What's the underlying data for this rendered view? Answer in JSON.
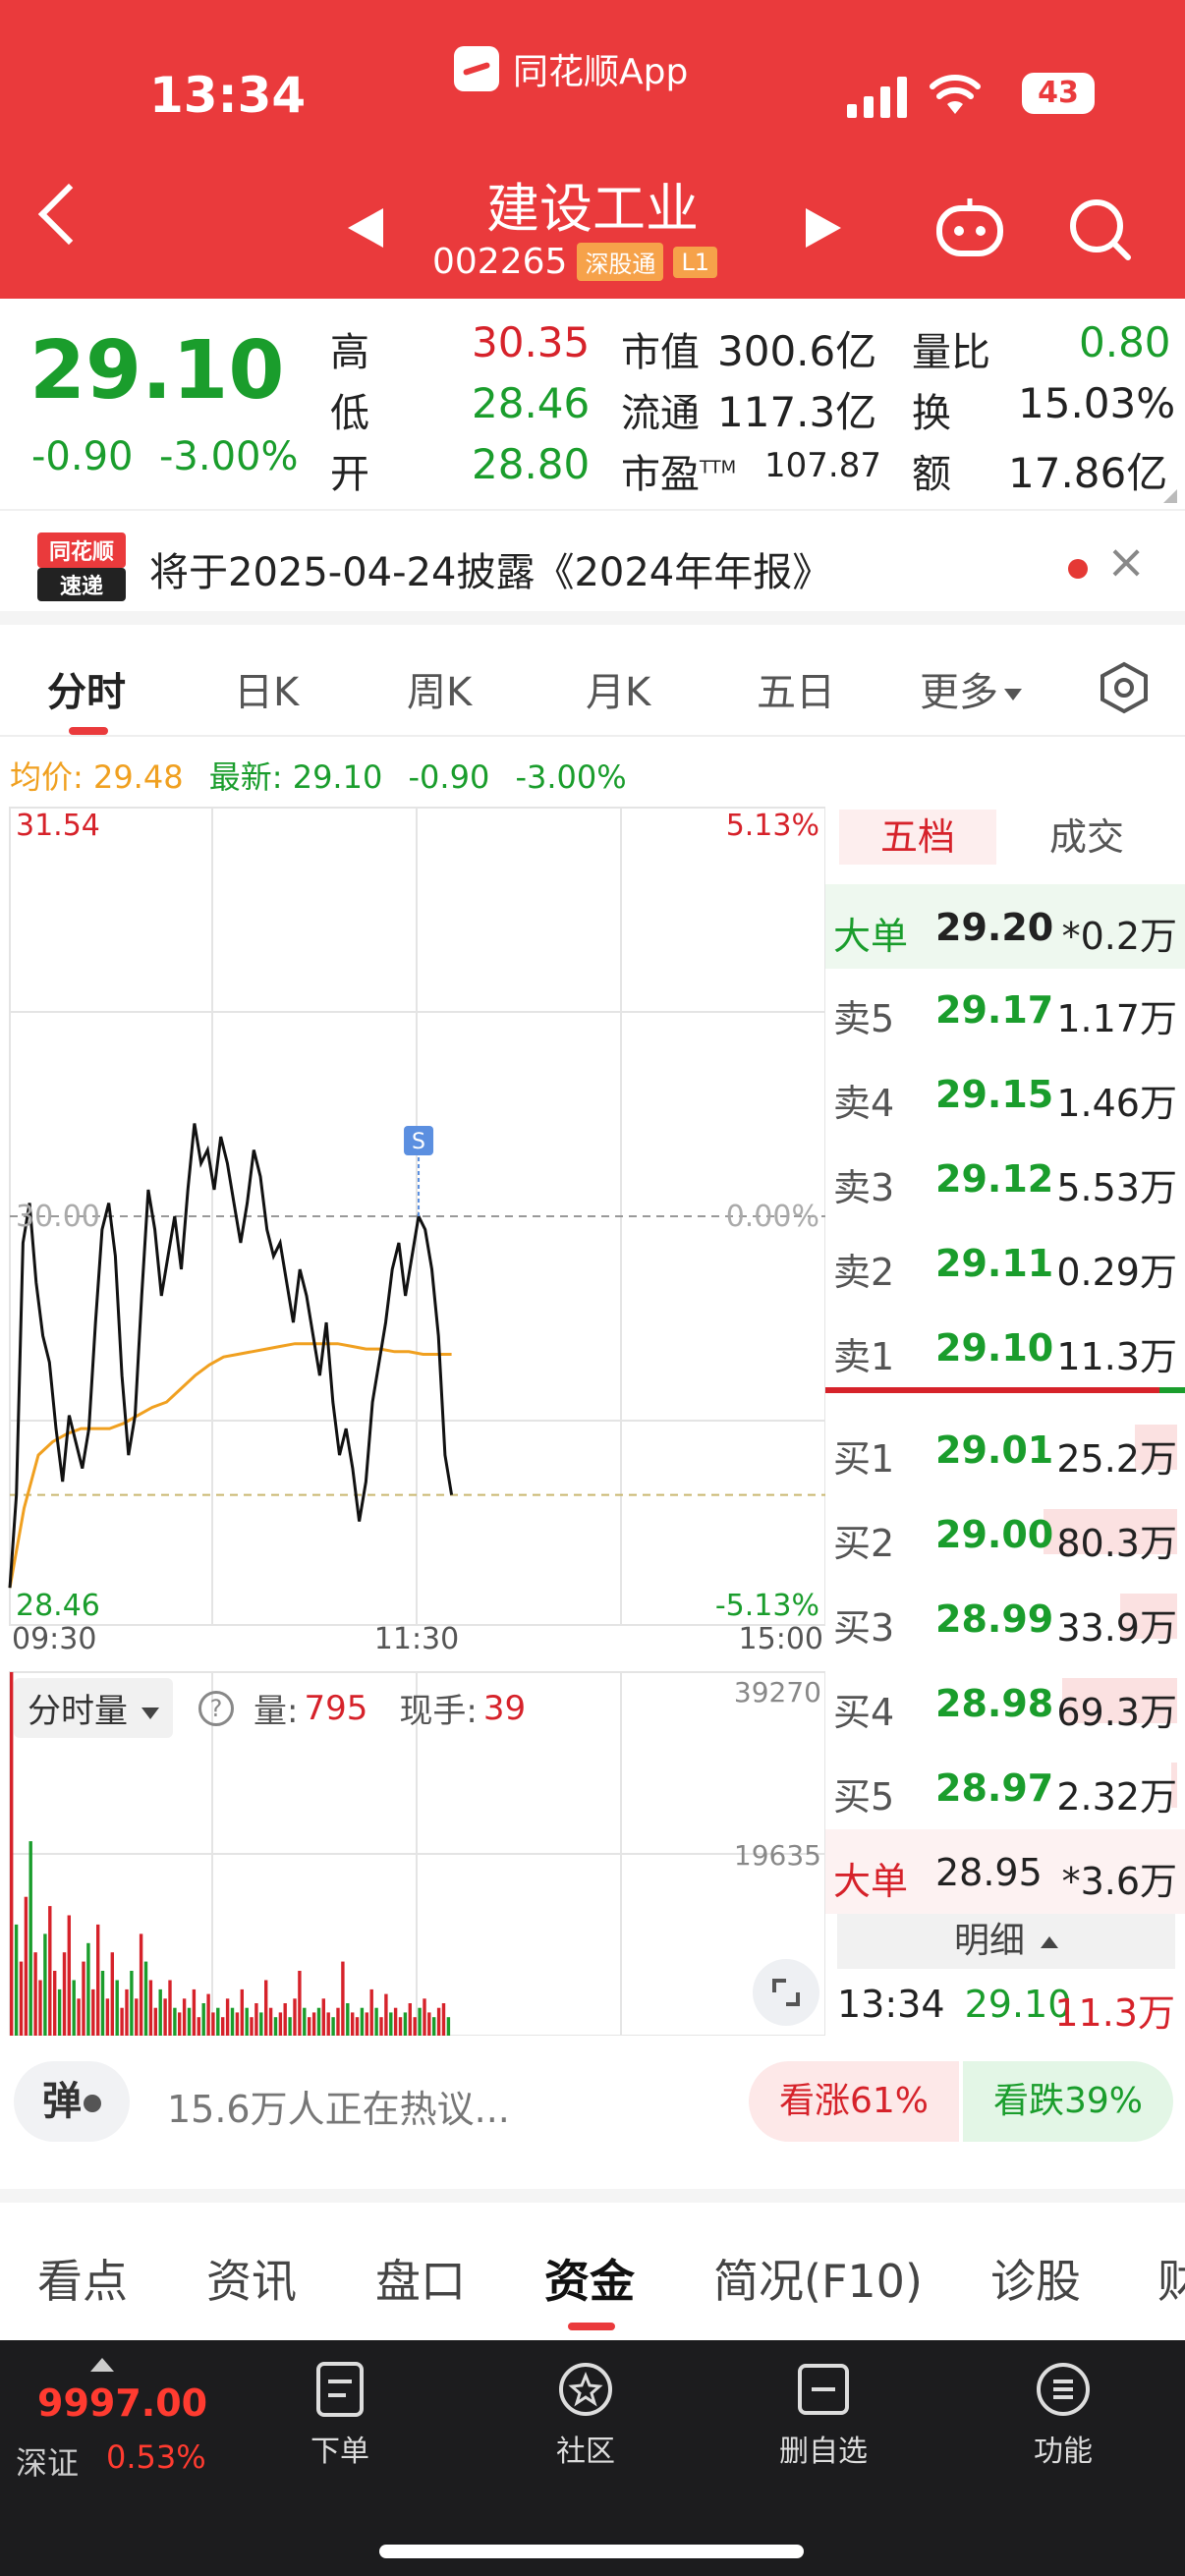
{
  "status": {
    "time": "13:34",
    "battery": "43"
  },
  "app": {
    "name": "同花顺App"
  },
  "stock": {
    "name": "建设工业",
    "code": "002265",
    "tags": [
      "深股通",
      "L1"
    ]
  },
  "quote": {
    "price": "29.10",
    "change": "-0.90",
    "change_pct": "-3.00%",
    "high_label": "高",
    "high": "30.35",
    "low_label": "低",
    "low": "28.46",
    "open_label": "开",
    "open": "28.80",
    "mktcap_label": "市值",
    "mktcap": "300.6亿",
    "float_label": "流通",
    "float": "117.3亿",
    "pe_label": "市盈",
    "pe_sup": "TTM",
    "pe": "107.87",
    "vol_ratio_label": "量比",
    "vol_ratio": "0.80",
    "turnover_label": "换",
    "turnover": "15.03%",
    "amount_label": "额",
    "amount": "17.86亿"
  },
  "notice": {
    "logo_top": "同花顺",
    "logo_bottom": "速递",
    "text": "将于2025-04-24披露《2024年年报》"
  },
  "period_tabs": [
    "分时",
    "日K",
    "周K",
    "月K",
    "五日",
    "更多"
  ],
  "avg_line": {
    "avg": "均价: 29.48",
    "latest": "最新: 29.10",
    "chg": "-0.90",
    "pct": "-3.00%"
  },
  "chart_data": {
    "type": "line",
    "title": "",
    "x_ticks": [
      "09:30",
      "11:30",
      "15:00"
    ],
    "ylim": [
      28.46,
      31.54
    ],
    "y_labels": {
      "top": "31.54",
      "mid": "30.00",
      "bottom": "28.46"
    },
    "pct_labels": {
      "top": "5.13%",
      "mid": "0.00%",
      "bottom": "-5.13%"
    },
    "prev_close": 30.0,
    "marker": "S",
    "series": [
      {
        "values": [
          28.6,
          28.95,
          29.9,
          30.05,
          29.75,
          29.55,
          29.45,
          29.2,
          29.0,
          29.25,
          29.15,
          29.05,
          29.2,
          29.6,
          29.95,
          30.05,
          29.85,
          29.4,
          29.1,
          29.25,
          29.7,
          30.1,
          29.95,
          29.7,
          29.85,
          30.0,
          29.8,
          30.1,
          30.35,
          30.2,
          30.25,
          30.1,
          30.3,
          30.2,
          30.05,
          29.9,
          30.05,
          30.25,
          30.15,
          29.95,
          29.85,
          29.9,
          29.75,
          29.6,
          29.8,
          29.7,
          29.55,
          29.4,
          29.6,
          29.3,
          29.1,
          29.2,
          29.05,
          28.85,
          29.0,
          29.3,
          29.45,
          29.6,
          29.8,
          29.9,
          29.7,
          29.85,
          30.0,
          29.95,
          29.8,
          29.55,
          29.1,
          28.95
        ]
      },
      {
        "values": [
          28.6,
          28.9,
          29.1,
          29.15,
          29.18,
          29.2,
          29.2,
          29.2,
          29.22,
          29.25,
          29.28,
          29.3,
          29.35,
          29.4,
          29.44,
          29.47,
          29.48,
          29.49,
          29.5,
          29.51,
          29.52,
          29.52,
          29.52,
          29.52,
          29.51,
          29.5,
          29.5,
          29.49,
          29.49,
          29.48,
          29.48,
          29.48
        ]
      }
    ],
    "volume": {
      "label": "分时量",
      "vol_label": "量:",
      "vol": "795",
      "hand_label": "现手:",
      "hand": "39",
      "y_labels": {
        "top": "39270",
        "mid": "19635"
      },
      "max": 39270,
      "values": [
        39270,
        12000,
        8000,
        15000,
        21000,
        9000,
        6000,
        11000,
        14000,
        7000,
        5000,
        9000,
        13000,
        6000,
        4000,
        8000,
        10000,
        5000,
        12000,
        7000,
        4000,
        9000,
        6000,
        3000,
        5000,
        7000,
        4000,
        11000,
        8000,
        6000,
        3000,
        5000,
        4000,
        6000,
        3000,
        2500,
        4000,
        3000,
        5000,
        2000,
        3500,
        4500,
        2500,
        3000,
        2000,
        4000,
        3000,
        2500,
        5000,
        3000,
        2000,
        3500,
        2500,
        6000,
        3000,
        2000,
        2500,
        3500,
        2000,
        4000,
        7000,
        3000,
        2000,
        2500,
        3000,
        4000,
        2500,
        2000,
        3000,
        8000,
        3500,
        2500,
        2000,
        3000,
        2500,
        5000,
        3000,
        2000,
        4500,
        2500,
        3000,
        2000,
        2500,
        3500,
        2000,
        3000,
        4000,
        2500,
        2000,
        3000,
        3500,
        2000
      ]
    }
  },
  "order_book": {
    "tabs": [
      "五档",
      "成交"
    ],
    "big_sell": {
      "label": "大单",
      "price": "29.20",
      "vol": "*0.2万"
    },
    "asks": [
      {
        "label": "卖5",
        "price": "29.17",
        "vol": "1.17万"
      },
      {
        "label": "卖4",
        "price": "29.15",
        "vol": "1.46万"
      },
      {
        "label": "卖3",
        "price": "29.12",
        "vol": "5.53万"
      },
      {
        "label": "卖2",
        "price": "29.11",
        "vol": "0.29万"
      },
      {
        "label": "卖1",
        "price": "29.10",
        "vol": "11.3万"
      }
    ],
    "bids": [
      {
        "label": "买1",
        "price": "29.01",
        "vol": "25.2万",
        "bar": 0.25
      },
      {
        "label": "买2",
        "price": "29.00",
        "vol": "80.3万",
        "bar": 0.8
      },
      {
        "label": "买3",
        "price": "28.99",
        "vol": "33.9万",
        "bar": 0.34
      },
      {
        "label": "买4",
        "price": "28.98",
        "vol": "69.3万",
        "bar": 0.69
      },
      {
        "label": "买5",
        "price": "28.97",
        "vol": "2.32万",
        "bar": 0.02
      }
    ],
    "big_buy": {
      "label": "大单",
      "price": "28.95",
      "vol": "*3.6万"
    },
    "detail_label": "明细",
    "detail": {
      "time": "13:34",
      "price": "29.10",
      "vol": "11.3万"
    }
  },
  "discussion": {
    "danmu": "弹",
    "text": "15.6万人正在热议...",
    "bull": "看涨61%",
    "bear": "看跌39%"
  },
  "info_tabs": [
    "看点",
    "资讯",
    "盘口",
    "资金",
    "简况(F10)",
    "诊股",
    "财"
  ],
  "bottom_nav": {
    "index_value": "9997.00",
    "index_name": "深证",
    "index_pct": "0.53%",
    "items": [
      "下单",
      "社区",
      "删自选",
      "功能"
    ]
  },
  "colors": {
    "brand": "#ea3a3c",
    "up": "#d6222a",
    "down": "#1a9d2c",
    "avg": "#f0a020"
  }
}
